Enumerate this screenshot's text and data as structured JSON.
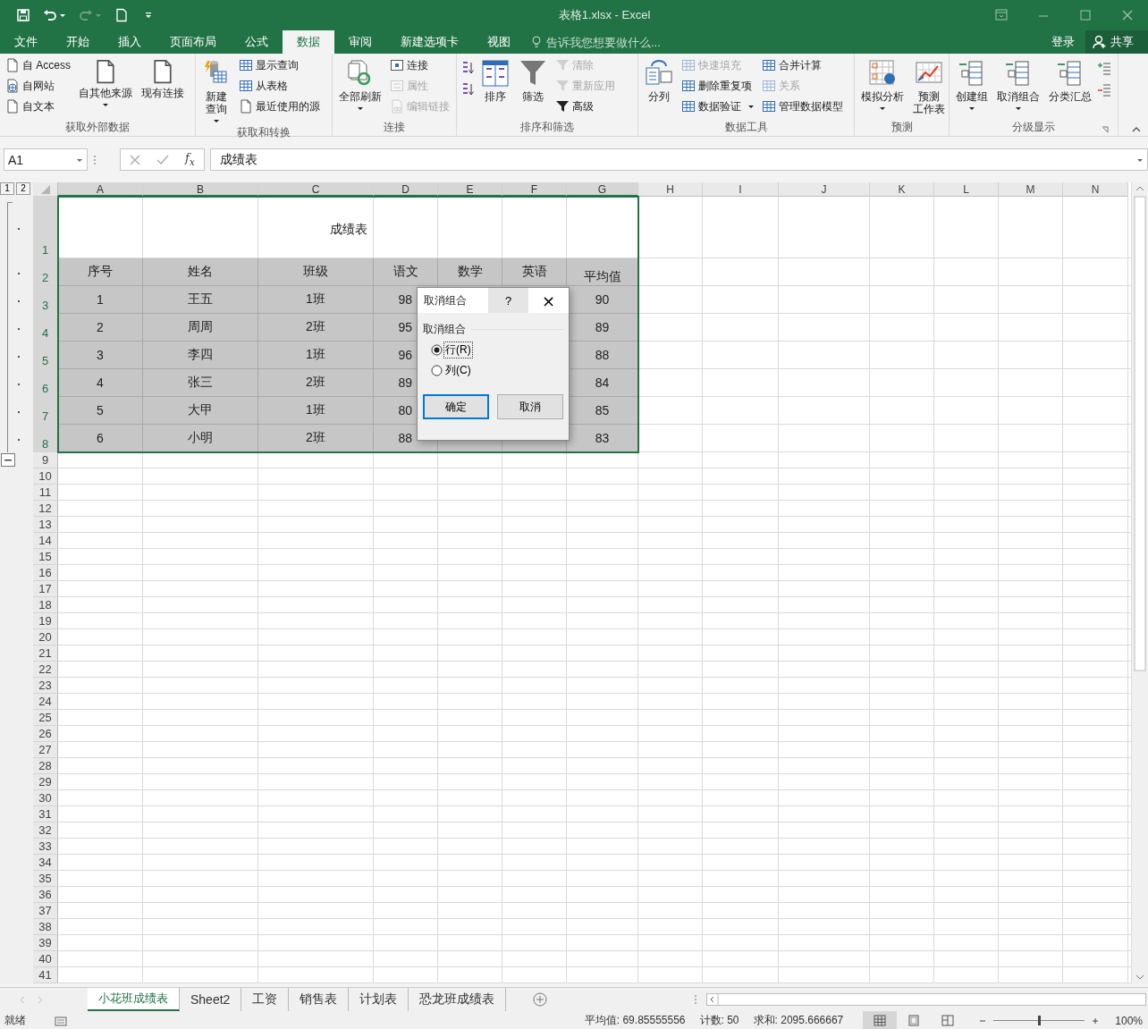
{
  "title_bar": {
    "title": "表格1.xlsx - Excel",
    "quick_access": [
      {
        "kind": "save",
        "disabled": false
      },
      {
        "kind": "undo",
        "disabled": false
      },
      {
        "kind": "redo",
        "disabled": true
      },
      {
        "kind": "new",
        "disabled": false
      },
      {
        "kind": "customize",
        "disabled": false
      }
    ]
  },
  "menu_tabs": [
    {
      "label": "文件",
      "selected": false
    },
    {
      "label": "开始",
      "selected": false
    },
    {
      "label": "插入",
      "selected": false
    },
    {
      "label": "页面布局",
      "selected": false
    },
    {
      "label": "公式",
      "selected": false
    },
    {
      "label": "数据",
      "selected": true
    },
    {
      "label": "审阅",
      "selected": false
    },
    {
      "label": "新建选项卡",
      "selected": false
    },
    {
      "label": "视图",
      "selected": false
    }
  ],
  "tell_me": {
    "placeholder": "告诉我您想要做什么..."
  },
  "sign_in": "登录",
  "share": "共享",
  "ribbon": [
    {
      "label": "获取外部数据",
      "items": [
        {
          "kind": "stack",
          "items": [
            {
              "label": "自 Access",
              "disabled": false
            },
            {
              "label": "自网站",
              "disabled": false
            },
            {
              "label": "自文本",
              "disabled": false
            }
          ]
        },
        {
          "kind": "large",
          "label": "自其他来源",
          "menu": true,
          "disabled": false
        },
        {
          "kind": "large",
          "label": "现有连接",
          "menu": false,
          "disabled": false
        }
      ]
    },
    {
      "label": "获取和转换",
      "items": [
        {
          "kind": "large",
          "lines": [
            "新建",
            "查询"
          ],
          "menu": true,
          "disabled": false
        },
        {
          "kind": "stack",
          "items": [
            {
              "label": "显示查询",
              "disabled": false
            },
            {
              "label": "从表格",
              "disabled": false
            },
            {
              "label": "最近使用的源",
              "disabled": false
            }
          ]
        }
      ]
    },
    {
      "label": "连接",
      "items": [
        {
          "kind": "large",
          "label": "全部刷新",
          "menu": true,
          "disabled": false
        },
        {
          "kind": "stack",
          "items": [
            {
              "label": "连接",
              "disabled": false
            },
            {
              "label": "属性",
              "disabled": true
            },
            {
              "label": "编辑链接",
              "disabled": true
            }
          ]
        }
      ]
    },
    {
      "label": "排序和筛选",
      "items": [
        {
          "kind": "icons",
          "items": [
            {
              "disabled": false
            },
            {
              "disabled": false
            }
          ]
        },
        {
          "kind": "large",
          "label": "排序",
          "menu": false,
          "disabled": false
        },
        {
          "kind": "large",
          "label": "筛选",
          "menu": false,
          "disabled": false
        },
        {
          "kind": "stack",
          "items": [
            {
              "label": "清除",
              "disabled": true
            },
            {
              "label": "重新应用",
              "disabled": true
            },
            {
              "label": "高级",
              "disabled": false
            }
          ]
        }
      ]
    },
    {
      "label": "数据工具",
      "items": [
        {
          "kind": "large",
          "label": "分列",
          "menu": false,
          "disabled": false
        },
        {
          "kind": "stack",
          "items": [
            {
              "label": "快速填充",
              "disabled": true
            },
            {
              "label": "删除重复项",
              "disabled": false
            },
            {
              "label": "数据验证",
              "disabled": false,
              "menu": true
            }
          ]
        },
        {
          "kind": "stack",
          "items": [
            {
              "label": "合并计算",
              "disabled": false
            },
            {
              "label": "关系",
              "disabled": true
            },
            {
              "label": "管理数据模型",
              "disabled": false
            }
          ]
        }
      ]
    },
    {
      "label": "预测",
      "items": [
        {
          "kind": "large",
          "label": "模拟分析",
          "menu": true,
          "disabled": false
        },
        {
          "kind": "large",
          "lines": [
            "预测",
            "工作表"
          ],
          "menu": false,
          "disabled": false
        }
      ]
    },
    {
      "label": "分级显示",
      "items": [
        {
          "kind": "large",
          "label": "创建组",
          "menu": true,
          "disabled": false
        },
        {
          "kind": "large",
          "label": "取消组合",
          "menu": true,
          "disabled": false
        },
        {
          "kind": "large",
          "label": "分类汇总",
          "menu": false,
          "disabled": false
        },
        {
          "kind": "icons",
          "items": [
            {
              "disabled": false
            },
            {
              "disabled": false
            }
          ]
        }
      ]
    }
  ],
  "formula_bar": {
    "name_box": "A1",
    "function_label": "f$_{x}$",
    "value": "成绩表"
  },
  "sheet": {
    "outline_levels": [
      "1",
      "2"
    ],
    "columns": [
      {
        "label": "A",
        "selected": true
      },
      {
        "label": "B",
        "selected": true
      },
      {
        "label": "C",
        "selected": true
      },
      {
        "label": "D",
        "selected": true
      },
      {
        "label": "E",
        "selected": true
      },
      {
        "label": "F",
        "selected": true
      },
      {
        "label": "G",
        "selected": true
      },
      {
        "label": "H",
        "selected": false
      },
      {
        "label": "I",
        "selected": false
      },
      {
        "label": "J",
        "selected": false
      },
      {
        "label": "K",
        "selected": false
      },
      {
        "label": "L",
        "selected": false
      },
      {
        "label": "M",
        "selected": false
      },
      {
        "label": "N",
        "selected": false
      }
    ],
    "rows": [
      {
        "number": "1",
        "kind": "title",
        "selected": true,
        "grouped": true,
        "cells": [
          "成绩表"
        ]
      },
      {
        "number": "2",
        "kind": "header",
        "selected": true,
        "grouped": true,
        "cells": [
          "序号",
          "姓名",
          "班级",
          "语文",
          "数学",
          "英语",
          "平均值"
        ]
      },
      {
        "number": "3",
        "kind": "data",
        "selected": true,
        "grouped": true,
        "cells": [
          "1",
          "王五",
          "1班",
          "98",
          null,
          null,
          "90"
        ]
      },
      {
        "number": "4",
        "kind": "data",
        "selected": true,
        "grouped": true,
        "cells": [
          "2",
          "周周",
          "2班",
          "95",
          null,
          null,
          "89"
        ]
      },
      {
        "number": "5",
        "kind": "data",
        "selected": true,
        "grouped": true,
        "cells": [
          "3",
          "李四",
          "1班",
          "96",
          null,
          null,
          "88"
        ]
      },
      {
        "number": "6",
        "kind": "data",
        "selected": true,
        "grouped": true,
        "cells": [
          "4",
          "张三",
          "2班",
          "89",
          null,
          null,
          "84"
        ]
      },
      {
        "number": "7",
        "kind": "data",
        "selected": true,
        "grouped": true,
        "cells": [
          "5",
          "大甲",
          "1班",
          "80",
          null,
          null,
          "85"
        ]
      },
      {
        "number": "8",
        "kind": "data",
        "selected": true,
        "grouped": true,
        "cells": [
          "6",
          "小明",
          "2班",
          "88",
          null,
          null,
          "83"
        ]
      },
      {
        "number": "9",
        "kind": "empty",
        "selected": false,
        "grouped": false
      },
      {
        "number": "10",
        "kind": "empty",
        "selected": false,
        "grouped": false
      },
      {
        "number": "11",
        "kind": "empty",
        "selected": false,
        "grouped": false
      },
      {
        "number": "12",
        "kind": "empty",
        "selected": false,
        "grouped": false
      },
      {
        "number": "13",
        "kind": "empty",
        "selected": false,
        "grouped": false
      },
      {
        "number": "14",
        "kind": "empty",
        "selected": false,
        "grouped": false
      },
      {
        "number": "15",
        "kind": "empty",
        "selected": false,
        "grouped": false
      },
      {
        "number": "16",
        "kind": "empty",
        "selected": false,
        "grouped": false
      },
      {
        "number": "17",
        "kind": "empty",
        "selected": false,
        "grouped": false
      },
      {
        "number": "18",
        "kind": "empty",
        "selected": false,
        "grouped": false
      },
      {
        "number": "19",
        "kind": "empty",
        "selected": false,
        "grouped": false
      },
      {
        "number": "20",
        "kind": "empty",
        "selected": false,
        "grouped": false
      },
      {
        "number": "21",
        "kind": "empty",
        "selected": false,
        "grouped": false
      },
      {
        "number": "22",
        "kind": "empty",
        "selected": false,
        "grouped": false
      },
      {
        "number": "23",
        "kind": "empty",
        "selected": false,
        "grouped": false
      },
      {
        "number": "24",
        "kind": "empty",
        "selected": false,
        "grouped": false
      },
      {
        "number": "25",
        "kind": "empty",
        "selected": false,
        "grouped": false
      },
      {
        "number": "26",
        "kind": "empty",
        "selected": false,
        "grouped": false
      },
      {
        "number": "27",
        "kind": "empty",
        "selected": false,
        "grouped": false
      },
      {
        "number": "28",
        "kind": "empty",
        "selected": false,
        "grouped": false
      },
      {
        "number": "29",
        "kind": "empty",
        "selected": false,
        "grouped": false
      },
      {
        "number": "30",
        "kind": "empty",
        "selected": false,
        "grouped": false
      },
      {
        "number": "31",
        "kind": "empty",
        "selected": false,
        "grouped": false
      },
      {
        "number": "32",
        "kind": "empty",
        "selected": false,
        "grouped": false
      },
      {
        "number": "33",
        "kind": "empty",
        "selected": false,
        "grouped": false
      },
      {
        "number": "34",
        "kind": "empty",
        "selected": false,
        "grouped": false
      },
      {
        "number": "35",
        "kind": "empty",
        "selected": false,
        "grouped": false
      },
      {
        "number": "36",
        "kind": "empty",
        "selected": false,
        "grouped": false
      },
      {
        "number": "37",
        "kind": "empty",
        "selected": false,
        "grouped": false
      },
      {
        "number": "38",
        "kind": "empty",
        "selected": false,
        "grouped": false
      },
      {
        "number": "39",
        "kind": "empty",
        "selected": false,
        "grouped": false
      },
      {
        "number": "40",
        "kind": "empty",
        "selected": false,
        "grouped": false
      },
      {
        "number": "41",
        "kind": "empty",
        "selected": false,
        "grouped": false
      }
    ]
  },
  "dialog": {
    "title": "取消组合",
    "help": "?",
    "close": "×",
    "group_label": "取消组合",
    "options": [
      {
        "label": "行(R)",
        "selected": true
      },
      {
        "label": "列(C)",
        "selected": false
      }
    ],
    "buttons": [
      {
        "label": "确定",
        "default": true
      },
      {
        "label": "取消",
        "default": false
      }
    ]
  },
  "sheet_tabs": [
    {
      "label": "小花班成绩表",
      "selected": true
    },
    {
      "label": "Sheet2",
      "selected": false
    },
    {
      "label": "工资",
      "selected": false
    },
    {
      "label": "销售表",
      "selected": false
    },
    {
      "label": "计划表",
      "selected": false
    },
    {
      "label": "恐龙班成绩表",
      "selected": false
    }
  ],
  "status_bar": {
    "mode": "就绪",
    "average": "平均值: 69.85555556",
    "count": "计数: 50",
    "sum": "求和: 2095.666667",
    "views": [
      {
        "kind": "normal",
        "selected": true
      },
      {
        "kind": "page_layout",
        "selected": false
      },
      {
        "kind": "page_break",
        "selected": false
      }
    ],
    "zoom": {
      "level": 0.5,
      "reading": "100%"
    }
  }
}
